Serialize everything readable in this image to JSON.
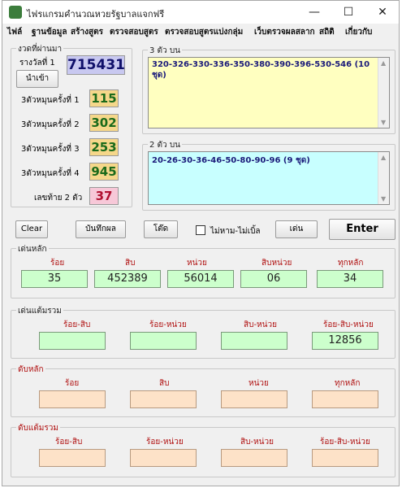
{
  "window": {
    "title": "ไฟรแกรมคำนวณหวยรัฐบาลแจกฟรี",
    "minimize": "—",
    "maximize": "☐",
    "close": "✕"
  },
  "menu": [
    "ไฟล์",
    "ฐานข้อมูล",
    "สร้างสูตร",
    "ตรวจสอบสูตร",
    "ตรวจสอบสูตรแบ่งกลุ่ม",
    "เว็บตรวจผลสลาก",
    "สถิติ",
    "เกี่ยวกับ"
  ],
  "past_results": {
    "group_title": "งวดที่ผ่านมา",
    "prize1_label": "รางวัลที่ 1",
    "prize1_value": "715431",
    "import_button": "นำเข้า",
    "rows": [
      {
        "label": "3ตัวหมุนครั้งที่ 1",
        "value": "115"
      },
      {
        "label": "3ตัวหมุนครั้งที่ 2",
        "value": "302"
      },
      {
        "label": "3ตัวหมุนครั้งที่ 3",
        "value": "253"
      },
      {
        "label": "3ตัวหมุนครั้งที่ 4",
        "value": "945"
      }
    ],
    "last2_label": "เลขท้าย 2 ตัว",
    "last2_value": "37"
  },
  "three_top": {
    "title": "3 ตัว บน",
    "content": "320-326-330-336-350-380-390-396-530-546  (10 ชุด)"
  },
  "two_top": {
    "title": "2 ตัว บน",
    "content": "20-26-30-36-46-50-80-90-96 (9 ชุด)"
  },
  "actions": {
    "clear": "Clear",
    "save": "บันทึกผล",
    "swap": "โต๊ด",
    "no_double_label": "ไม่หาม-ไม่เบิ้ล",
    "play": "เด่น",
    "enter": "Enter"
  },
  "main_play": {
    "title": "เด่นหลัก",
    "labels": [
      "ร้อย",
      "สิบ",
      "หน่วย",
      "สิบหน่วย",
      "ทุกหลัก"
    ],
    "values": [
      "35",
      "452389",
      "56014",
      "06",
      "34"
    ]
  },
  "combo_play": {
    "title": "เด่นแต้มรวม",
    "labels": [
      "ร้อย-สิบ",
      "ร้อย-หน่วย",
      "สิบ-หน่วย",
      "ร้อย-สิบ-หน่วย"
    ],
    "values": [
      "",
      "",
      "",
      "12856"
    ]
  },
  "main_out": {
    "title": "ดับหลัก",
    "labels": [
      "ร้อย",
      "สิบ",
      "หน่วย",
      "ทุกหลัก"
    ],
    "values": [
      "",
      "",
      "",
      ""
    ]
  },
  "combo_out": {
    "title": "ดับแต้มรวม",
    "labels": [
      "ร้อย-สิบ",
      "ร้อย-หน่วย",
      "สิบ-หน่วย",
      "ร้อย-สิบ-หน่วย"
    ],
    "values": [
      "",
      "",
      "",
      ""
    ]
  },
  "colors": {
    "prize1_bg": "#c8c8f0",
    "three_digit_bg": "#f5d78a",
    "last2_bg": "#f7c8d8",
    "memo3_bg": "#ffffc0",
    "memo2_bg": "#c8ffff",
    "field_green": "#ccffcc",
    "field_peach": "#fde2c8"
  }
}
